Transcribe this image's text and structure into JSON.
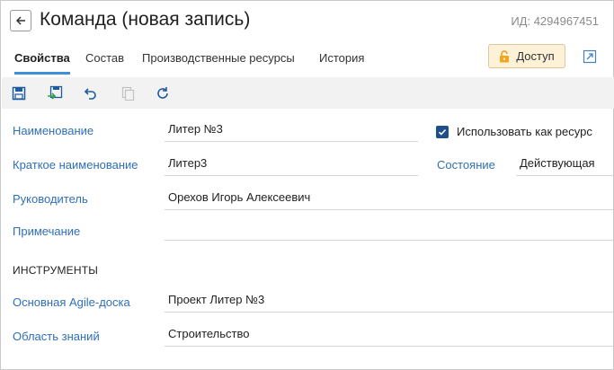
{
  "header": {
    "title": "Команда (новая запись)",
    "record_id": "ИД: 4294967451"
  },
  "tabs": [
    {
      "label": "Свойства",
      "active": true
    },
    {
      "label": "Состав",
      "active": false
    },
    {
      "label": "Производственные ресурсы",
      "active": false
    },
    {
      "label": "История",
      "active": false
    }
  ],
  "access_button": {
    "label": "Доступ"
  },
  "toolbar": {
    "icons": [
      "save-icon",
      "save-and-close-icon",
      "undo-icon",
      "copy-icon",
      "refresh-icon"
    ]
  },
  "form": {
    "name": {
      "label": "Наименование",
      "value": "Литер №3"
    },
    "short_name": {
      "label": "Краткое наименование",
      "value": "Литер3"
    },
    "manager": {
      "label": "Руководитель",
      "value": "Орехов Игорь Алексеевич"
    },
    "note": {
      "label": "Примечание",
      "value": ""
    },
    "use_as_resource": {
      "label": "Использовать как ресурс",
      "checked": true
    },
    "state": {
      "label": "Состояние",
      "value": "Действующая"
    }
  },
  "tools_section": {
    "title": "ИНСТРУМЕНТЫ",
    "agile_board": {
      "label": "Основная Agile-доска",
      "value": "Проект Литер №3"
    },
    "knowledge_area": {
      "label": "Область знаний",
      "value": "Строительство"
    }
  },
  "colors": {
    "accent": "#3d8fd9",
    "label_link": "#2f6fb7",
    "toolbar_bg": "#f2f2f2",
    "access_bg": "#fdf1d8",
    "checkbox": "#1e4f8a"
  }
}
